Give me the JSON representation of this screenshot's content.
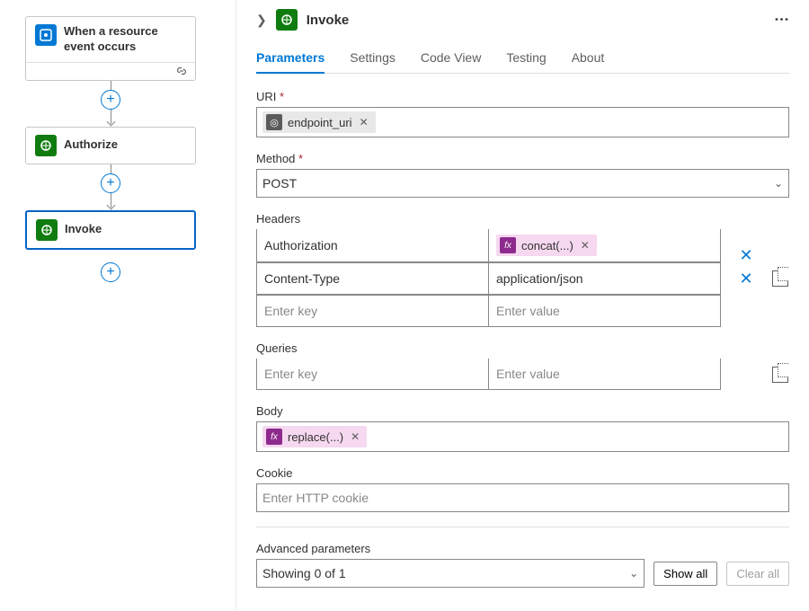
{
  "flow": {
    "nodes": [
      {
        "id": "trigger",
        "title": "When a resource event occurs",
        "iconClass": "ic-blue",
        "iconName": "event-icon",
        "hasLinkRow": true,
        "selected": false
      },
      {
        "id": "authorize",
        "title": "Authorize",
        "iconClass": "ic-green",
        "iconName": "http-icon",
        "hasLinkRow": false,
        "selected": false
      },
      {
        "id": "invoke",
        "title": "Invoke",
        "iconClass": "ic-green",
        "iconName": "http-icon",
        "hasLinkRow": false,
        "selected": true
      }
    ]
  },
  "panel": {
    "title": "Invoke",
    "tabs": [
      "Parameters",
      "Settings",
      "Code View",
      "Testing",
      "About"
    ],
    "activeTab": 0,
    "labels": {
      "uri": "URI",
      "method": "Method",
      "headers": "Headers",
      "queries": "Queries",
      "body": "Body",
      "cookie": "Cookie",
      "advanced": "Advanced parameters"
    },
    "uri_pill": "endpoint_uri",
    "method_value": "POST",
    "headers": [
      {
        "key": "Authorization",
        "value_type": "fx",
        "value": "concat(...)"
      },
      {
        "key": "Content-Type",
        "value_type": "text",
        "value": "application/json"
      }
    ],
    "headers_placeholder_key": "Enter key",
    "headers_placeholder_value": "Enter value",
    "queries_placeholder_key": "Enter key",
    "queries_placeholder_value": "Enter value",
    "body_pill": "replace(...)",
    "cookie_placeholder": "Enter HTTP cookie",
    "advanced_value": "Showing 0 of 1",
    "show_all": "Show all",
    "clear_all": "Clear all"
  }
}
